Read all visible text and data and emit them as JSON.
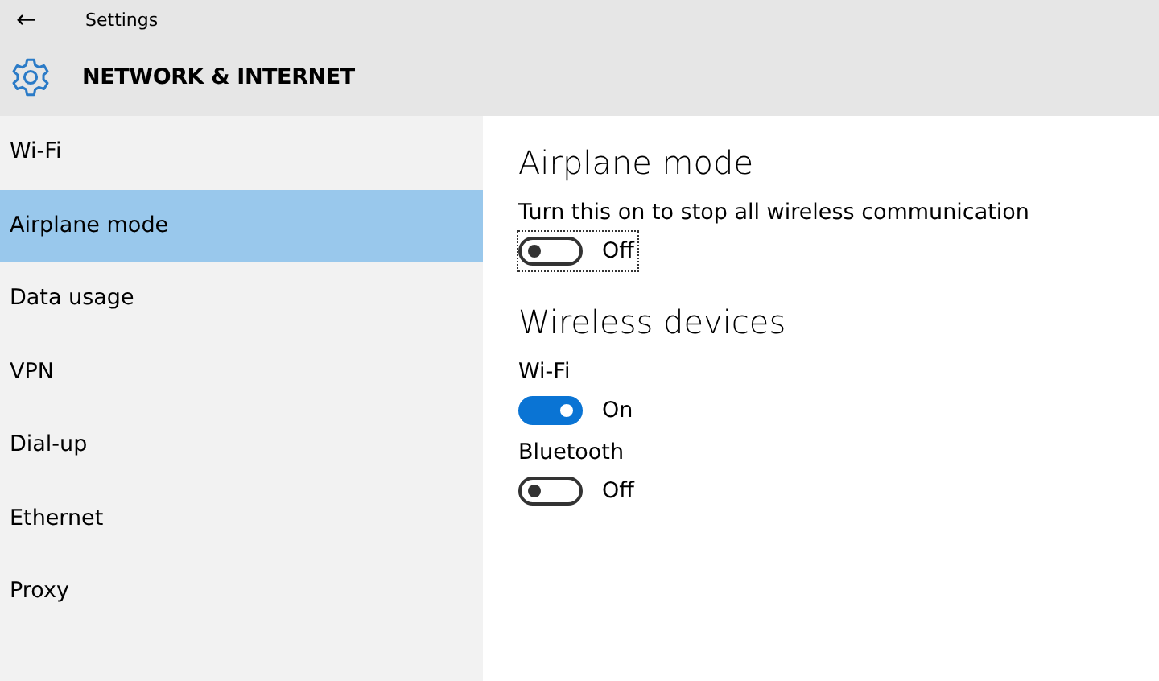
{
  "window": {
    "title": "Settings",
    "back": "←"
  },
  "header": {
    "title": "NETWORK & INTERNET"
  },
  "sidebar": {
    "items": [
      {
        "label": "Wi-Fi",
        "selected": false
      },
      {
        "label": "Airplane mode",
        "selected": true
      },
      {
        "label": "Data usage",
        "selected": false
      },
      {
        "label": "VPN",
        "selected": false
      },
      {
        "label": "Dial-up",
        "selected": false
      },
      {
        "label": "Ethernet",
        "selected": false
      },
      {
        "label": "Proxy",
        "selected": false
      }
    ]
  },
  "sections": [
    {
      "heading": "Airplane mode",
      "settings": [
        {
          "label": "Turn this on to stop all wireless communication",
          "on": false,
          "focused": true,
          "state_text": "Off"
        }
      ]
    },
    {
      "heading": "Wireless devices",
      "settings": [
        {
          "label": "Wi-Fi",
          "on": true,
          "focused": false,
          "state_text": "On"
        },
        {
          "label": "Bluetooth",
          "on": false,
          "focused": false,
          "state_text": "Off"
        }
      ]
    }
  ]
}
